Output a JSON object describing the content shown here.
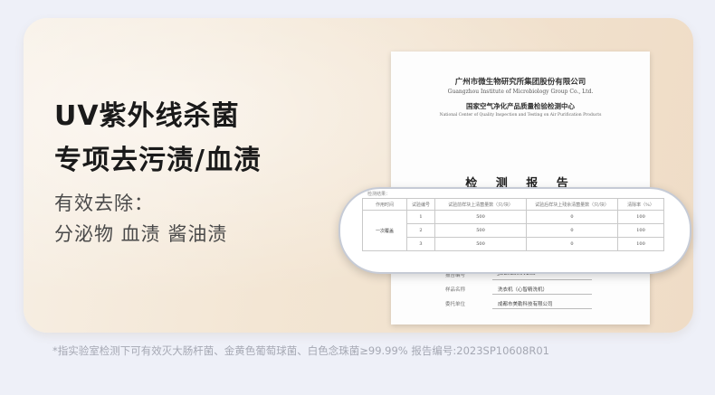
{
  "headline": {
    "line1": "UV紫外线杀菌",
    "line2": "专项去污渍/血渍"
  },
  "subtitle": {
    "line1": "有效去除：",
    "line2": "分泌物 血渍 酱油渍"
  },
  "report": {
    "org_cn": "广州市微生物研究所集团股份有限公司",
    "org_en": "Guangzhou Institute of Microbiology Group Co., Ltd.",
    "center_cn": "国家空气净化产品质量检验检测中心",
    "center_en": "National Center of Quality Inspection and Testing on Air Purification Products",
    "title": "检 测 报 告",
    "meta": [
      {
        "label": "报告编号",
        "value": "JD2923001263"
      },
      {
        "label": "样品名称",
        "value": "洗衣机（心智精洗机）"
      },
      {
        "label": "委托单位",
        "value": "成都市美勒科技有限公司"
      }
    ]
  },
  "results_table": {
    "label": "检测结果：",
    "headers": [
      "作用时间",
      "试验编号",
      "试验前样块上清菌量数（只/块）",
      "试验后样块上残余清菌量数（只/块）",
      "清除率（%）"
    ],
    "group_label": "一次覆盖",
    "rows": [
      {
        "id": "1",
        "before": "500",
        "after": "0",
        "rate": "100"
      },
      {
        "id": "2",
        "before": "500",
        "after": "0",
        "rate": "100"
      },
      {
        "id": "3",
        "before": "500",
        "after": "0",
        "rate": "100"
      }
    ]
  },
  "footnote": "*指实验室检测下可有效灭大肠杆菌、金黄色葡萄球菌、白色念珠菌≥99.99% 报告编号:2023SP10608R01"
}
